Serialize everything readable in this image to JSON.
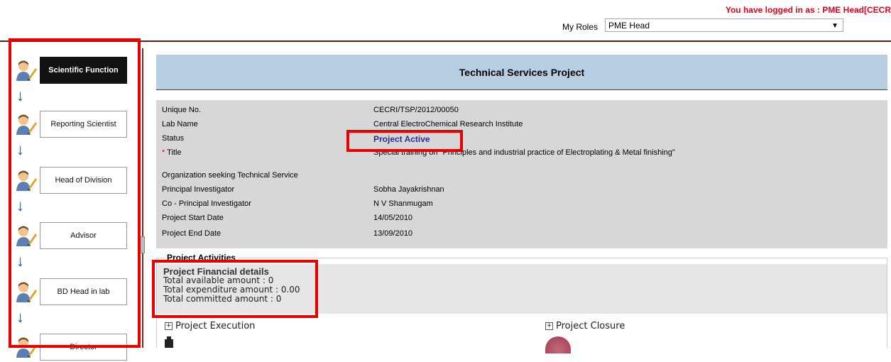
{
  "header": {
    "login_text": "You have logged in as : PME Head[CECR",
    "roles_label": "My Roles",
    "roles_selected": "PME Head"
  },
  "workflow": {
    "steps": [
      {
        "label": "Scientific Function",
        "active": true
      },
      {
        "label": "Reporting Scientist",
        "active": false
      },
      {
        "label": "Head of Division",
        "active": false
      },
      {
        "label": "Advisor",
        "active": false
      },
      {
        "label": "BD Head in lab",
        "active": false
      },
      {
        "label": "Director",
        "active": false
      }
    ]
  },
  "project": {
    "title": "Technical Services Project",
    "fields": [
      {
        "label": "Unique No.",
        "value": "CECRI/TSP/2012/00050"
      },
      {
        "label": "Lab Name",
        "value": "Central ElectroChemical Research Institute"
      },
      {
        "label": "Status",
        "value": "Project Active"
      },
      {
        "label": "Title",
        "value": "Special training on \"Principles and industrial practice of Electroplating & Metal finishing\"",
        "required_mark": "*"
      },
      {
        "label": "Organization seeking Technical Service",
        "value": ""
      },
      {
        "label": "Principal Investigator",
        "value": "Sobha Jayakrishnan"
      },
      {
        "label": "Co - Principal Investigator",
        "value": "N V Shanmugam"
      },
      {
        "label": "Project Start Date",
        "value": "14/05/2010"
      },
      {
        "label": "Project End Date",
        "value": "13/09/2010"
      }
    ]
  },
  "activities": {
    "legend": "Project Activities",
    "financial_title": "Project Financial details",
    "available": "Total available amount : 0",
    "expenditure": "Total expenditure amount : 0.00",
    "committed": "Total committed amount : 0",
    "execution_label": "Project Execution",
    "closure_label": "Project Closure",
    "expand_glyph": "+"
  },
  "colors": {
    "title_bar": "#b7cfe3",
    "details_bg": "#d7d7d7",
    "login_text": "#e8001c",
    "status_text": "#2c2a8f",
    "highlight_frame": "#e80000"
  }
}
